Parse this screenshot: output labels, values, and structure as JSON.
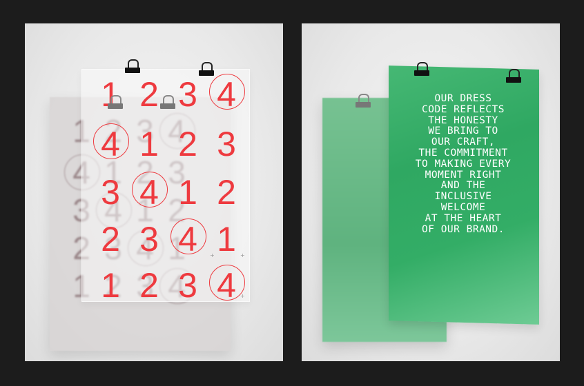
{
  "left_photo": {
    "front_rows": [
      [
        "1",
        "2",
        "3",
        "4"
      ],
      [
        "4",
        "1",
        "2",
        "3"
      ],
      [
        "3",
        "4",
        "1",
        "2"
      ],
      [
        "2",
        "3",
        "4",
        "1"
      ],
      [
        "1",
        "2",
        "3",
        "4"
      ]
    ],
    "back_rows": [
      [
        "1",
        "2",
        "3",
        "4"
      ],
      [
        "4",
        "1",
        "2",
        "3"
      ],
      [
        "3",
        "4",
        "1",
        "2"
      ],
      [
        "2",
        "3",
        "4",
        "1"
      ],
      [
        "1",
        "2",
        "3",
        "4"
      ]
    ],
    "accent_color": "#ee3a3f",
    "back_color": "#8a6b70"
  },
  "right_photo": {
    "poster_lines": [
      "OUR DRESS",
      "CODE REFLECTS",
      "THE HONESTY",
      "WE BRING TO",
      "OUR CRAFT,",
      "THE COMMITMENT",
      "TO MAKING EVERY",
      "MOMENT RIGHT",
      "AND THE",
      "INCLUSIVE",
      "WELCOME",
      "AT THE HEART",
      "OF OUR BRAND."
    ],
    "poster_color": "#2fa862",
    "text_color": "#ffffff"
  }
}
